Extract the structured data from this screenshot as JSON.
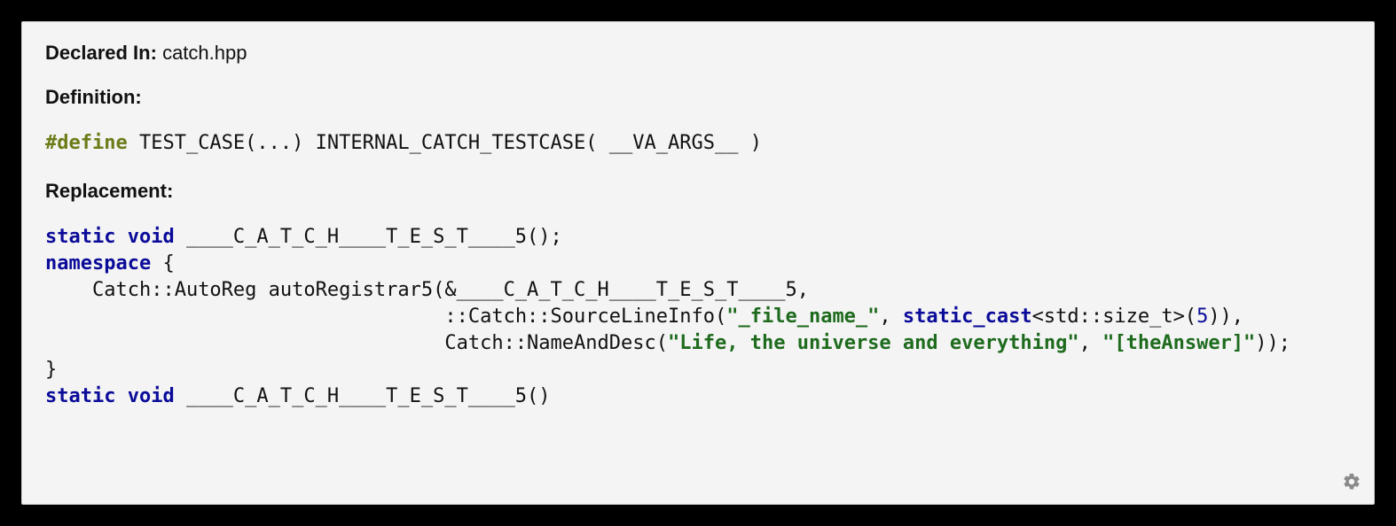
{
  "meta": {
    "declared_in_label": "Declared In:",
    "declared_in_value": "catch.hpp"
  },
  "definition": {
    "label": "Definition:",
    "tokens": {
      "define": "#define",
      "rest": " TEST_CASE(...) INTERNAL_CATCH_TESTCASE( __VA_ARGS__ )"
    }
  },
  "replacement": {
    "label": "Replacement:",
    "line1": {
      "kw": "static void",
      "rest": " ____C_A_T_C_H____T_E_S_T____5();"
    },
    "line2": {
      "kw": "namespace",
      "rest": " {"
    },
    "line3": {
      "indent": "    ",
      "text": "Catch::AutoReg autoRegistrar5(&____C_A_T_C_H____T_E_S_T____5,"
    },
    "line4": {
      "indent": "                                  ",
      "pre": "::Catch::SourceLineInfo(",
      "str1": "\"_file_name_\"",
      "mid1": ", ",
      "kw": "static_cast",
      "mid2": "<std::size_t>(",
      "num": "5",
      "post": ")),"
    },
    "line5": {
      "indent": "                                  ",
      "pre": "Catch::NameAndDesc(",
      "str1": "\"Life, the universe and everything\"",
      "mid": ", ",
      "str2": "\"[theAnswer]\"",
      "post": "));"
    },
    "line6": {
      "text": "}"
    },
    "line7": {
      "kw": "static void",
      "rest": " ____C_A_T_C_H____T_E_S_T____5()"
    }
  }
}
